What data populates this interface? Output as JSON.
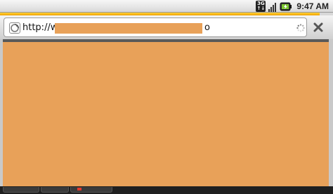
{
  "status_bar": {
    "network_badge_top": "3G",
    "network_badge_bottom": "↑↓",
    "time": "9:47 AM",
    "icons": [
      "3g-data-icon",
      "signal-strength-icon",
      "battery-charging-icon"
    ]
  },
  "browser": {
    "load_progress_percent": 96,
    "url_prefix": "http://w",
    "url_suffix": "o",
    "favicon": "globe-page-icon",
    "loading_indicator": "loading-spinner-icon",
    "stop_icon": "close-icon"
  },
  "tabs": {
    "count": 3
  },
  "colors": {
    "progress": "#f4b400",
    "redaction": "#e8a159",
    "tab_marker": "#e03a2e"
  }
}
